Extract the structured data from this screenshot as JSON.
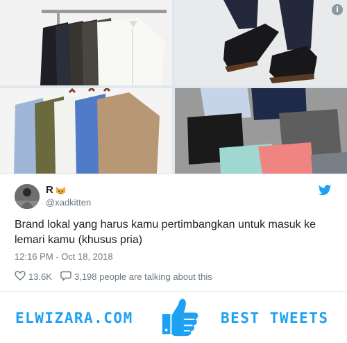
{
  "media": {
    "photos": [
      {
        "name": "dark-shirts-on-rack-photo"
      },
      {
        "name": "black-oxford-shoes-photo"
      },
      {
        "name": "colored-shirts-on-hangers-photo"
      },
      {
        "name": "folded-shirts-photo"
      }
    ],
    "info_label": "i"
  },
  "tweet": {
    "display_name": "R",
    "handle": "@xadkitten",
    "text": "Brand lokal yang harus kamu pertimbangkan untuk masuk ke lemari kamu (khusus pria)",
    "timestamp": "12:16 PM - Oct 18, 2018",
    "likes": "13.6K",
    "replies": "3,198 people are talking about this"
  },
  "banner": {
    "site": "ELWIZARA.COM",
    "tagline": "BEST TWEETS"
  },
  "colors": {
    "accent": "#1da1f2",
    "text": "#1c2022",
    "muted": "#697882"
  }
}
